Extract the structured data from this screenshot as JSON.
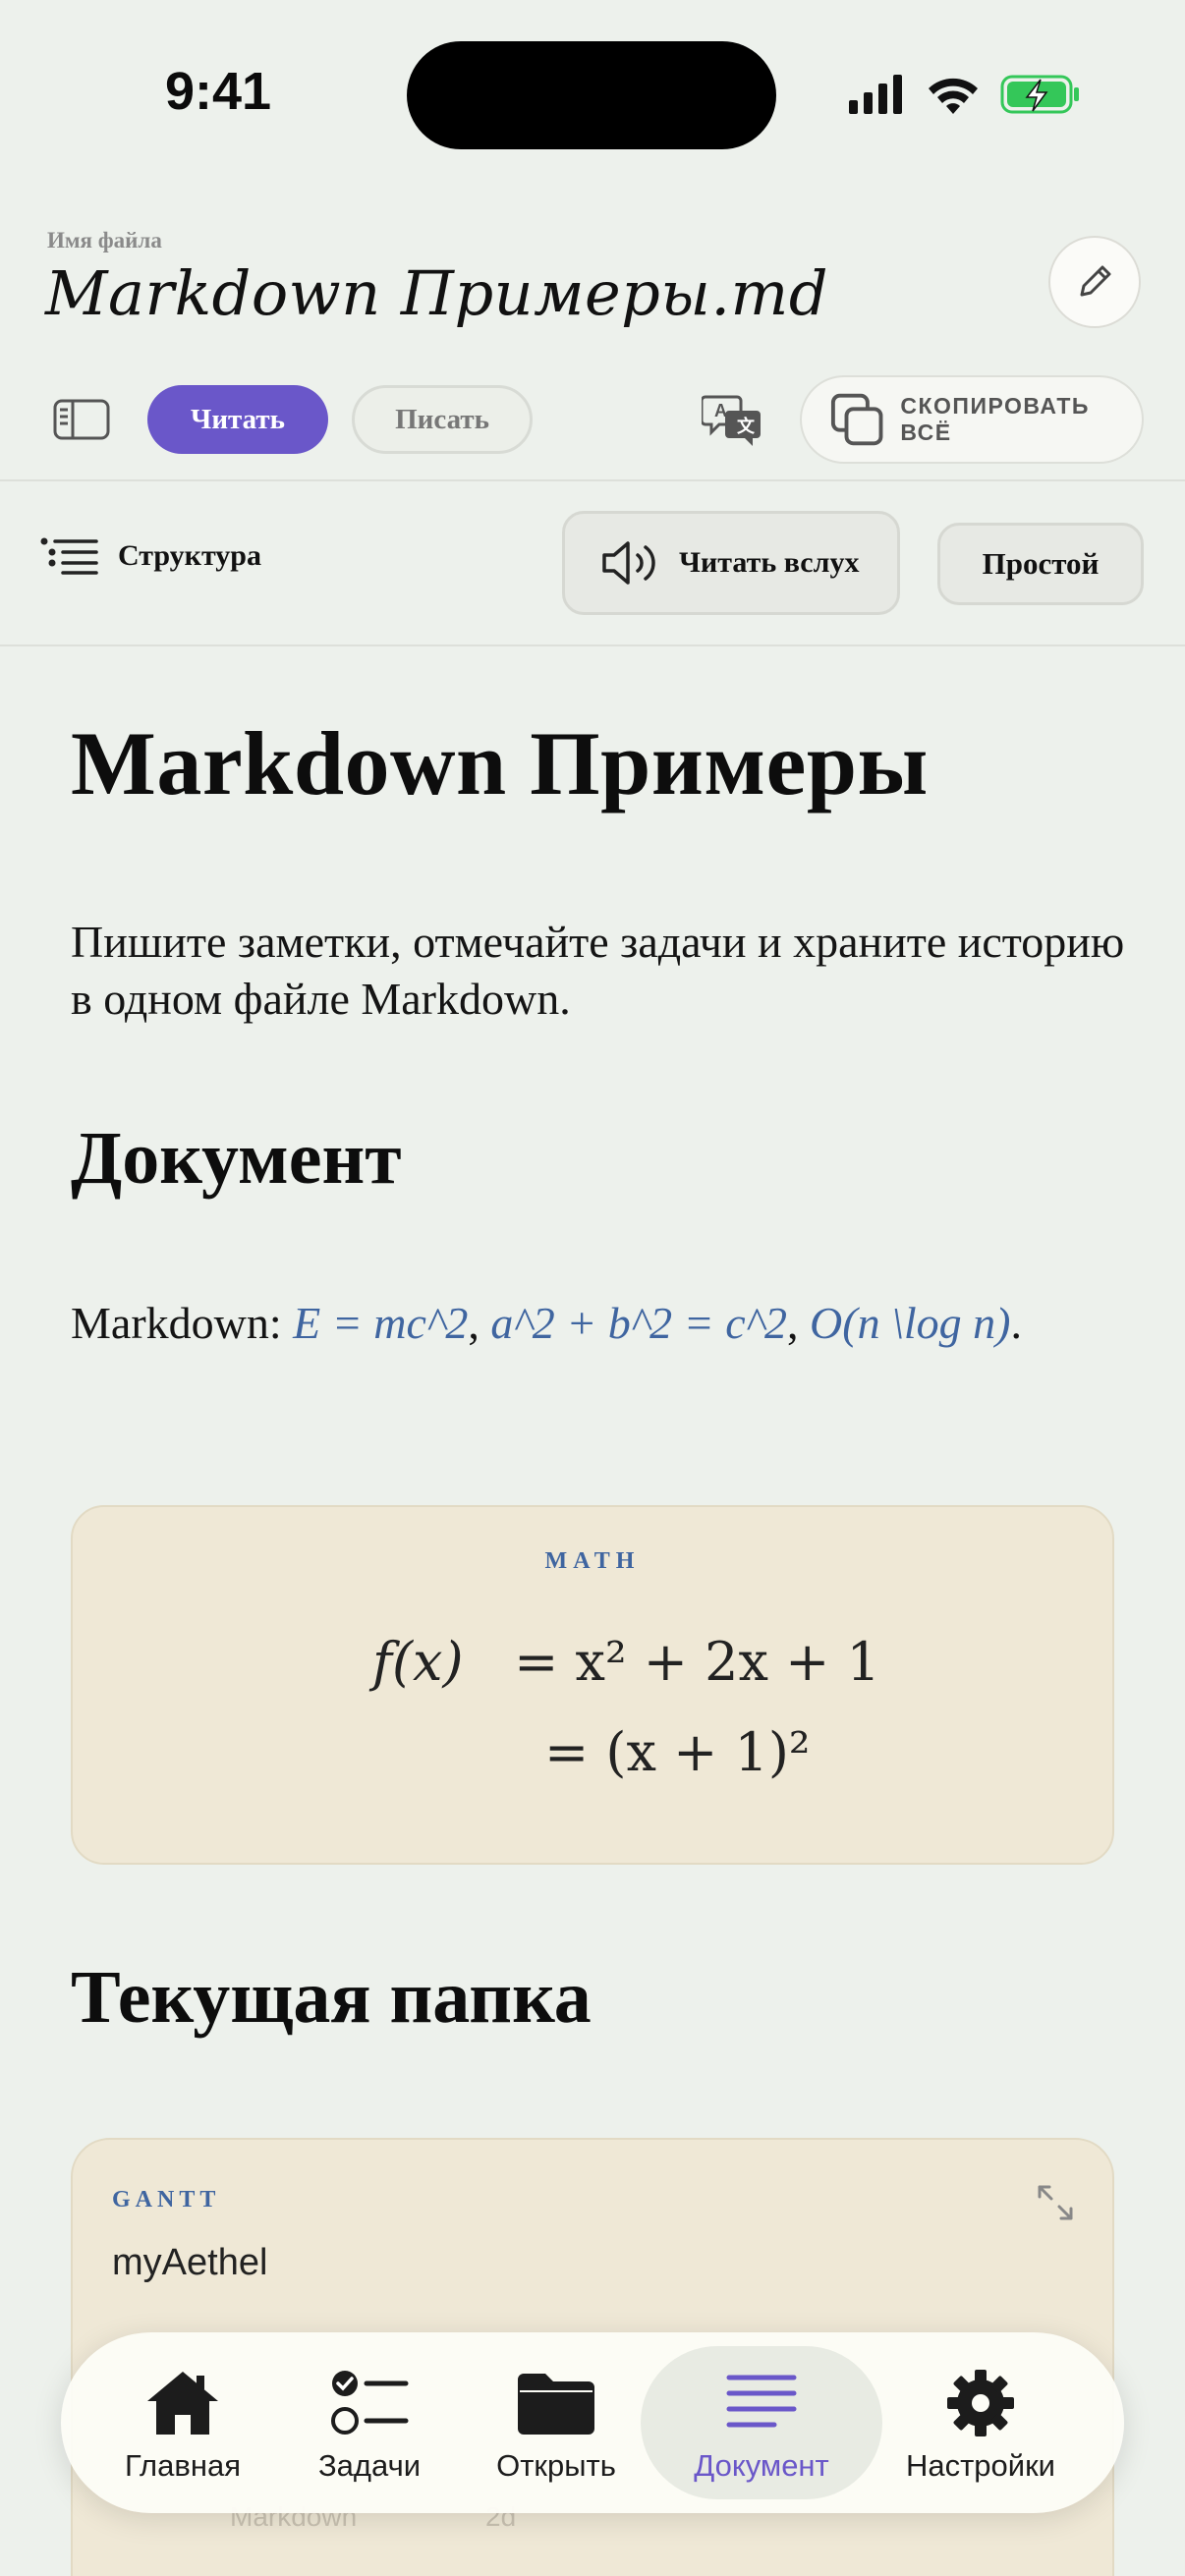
{
  "status_bar": {
    "time": "9:41"
  },
  "header": {
    "file_label": "Имя файла",
    "file_title": "Markdown Примеры.md"
  },
  "toolbar": {
    "read_label": "Читать",
    "write_label": "Писать",
    "copy_all_label": "СКОПИРОВАТЬ ВСЁ",
    "active_mode": "read"
  },
  "subtoolbar": {
    "structure_label": "Структура",
    "read_aloud_label": "Читать вслух",
    "plain_label": "Простой"
  },
  "document": {
    "title": "Markdown Примеры",
    "intro": "Пишите заметки, отмечайте задачи и храните историю в одном файле Markdown.",
    "section_doc": "Документ",
    "inline_prefix": "Markdown: ",
    "inline_math": [
      "E = mc^2",
      "a^2 + b^2 = c^2",
      "O(n \\log n)"
    ],
    "math_block": {
      "tag": "MATH",
      "line1_lhs": "f(x)",
      "line1_rhs": "= x² + 2x + 1",
      "line2": "= (x + 1)²"
    },
    "section_folder": "Текущая папка",
    "gantt": {
      "tag": "GANTT",
      "title": "myAethel",
      "faint_row_label": "Markdown",
      "faint_value": "2d"
    }
  },
  "tab_bar": {
    "tabs": [
      {
        "label": "Главная",
        "icon": "home-icon"
      },
      {
        "label": "Задачи",
        "icon": "tasks-icon"
      },
      {
        "label": "Открыть",
        "icon": "folder-icon"
      },
      {
        "label": "Документ",
        "icon": "document-icon",
        "active": true
      },
      {
        "label": "Настройки",
        "icon": "gear-icon"
      }
    ]
  },
  "colors": {
    "accent": "#6a57c9",
    "math": "#3f65a0",
    "card": "#efe8d6",
    "background": "#edf1ec",
    "battery": "#34c759"
  }
}
